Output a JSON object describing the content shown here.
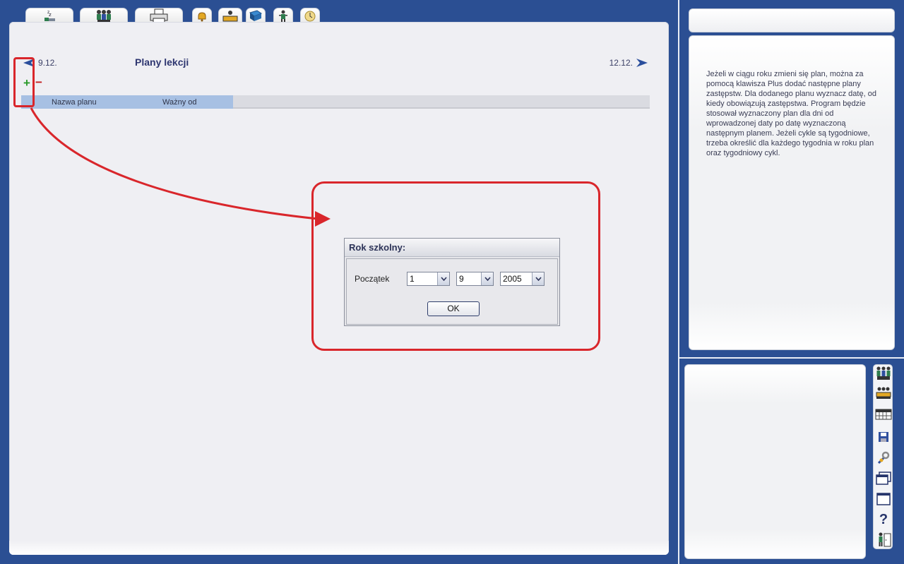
{
  "tabs": [
    {
      "name": "sleep-tab",
      "icon": "zzz-icon"
    },
    {
      "name": "people-tab",
      "icon": "people-icon"
    },
    {
      "name": "print-tab",
      "icon": "printer-icon"
    },
    {
      "name": "bell-tab",
      "icon": "bell-icon"
    },
    {
      "name": "desk-tab",
      "icon": "desk-icon"
    },
    {
      "name": "book-tab",
      "icon": "book-icon"
    },
    {
      "name": "person-tab",
      "icon": "person-icon"
    },
    {
      "name": "clock-tab",
      "icon": "clock-icon"
    }
  ],
  "nav": {
    "prev_date": "9.12.",
    "next_date": "12.12.",
    "title": "Plany lekcji"
  },
  "controls": {
    "add": "+",
    "remove": "−"
  },
  "table": {
    "columns": [
      "Nazwa planu",
      "Ważny od"
    ]
  },
  "dialog": {
    "title": "Rok szkolny:",
    "label_start": "Początek",
    "day": "1",
    "month": "9",
    "year": "2005",
    "ok": "OK"
  },
  "help": {
    "text": "Jeżeli w ciągu roku zmieni się plan, można za pomocą klawisza Plus dodać następne plany zastępstw. Dla dodanego planu wyznacz datę, od kiedy obowiązują zastępstwa. Program będzie stosował wyznaczony plan dla dni od wprowadzonej daty po datę wyznaczoną następnym planem. Jeżeli cykle są tygodniowe, trzeba określić dla każdego tygodnia w roku plan oraz tygodniowy cykl."
  },
  "toolbar": {
    "help_glyph": "?",
    "icons": [
      "teachers-icon",
      "classes-icon",
      "timetable-icon",
      "save-icon",
      "settings-icon",
      "windows-icon",
      "window-icon",
      "help-icon",
      "exit-icon"
    ]
  },
  "colors": {
    "background": "#2b4f93",
    "accent": "#d9262b",
    "header_highlight": "#a7c0e3"
  }
}
